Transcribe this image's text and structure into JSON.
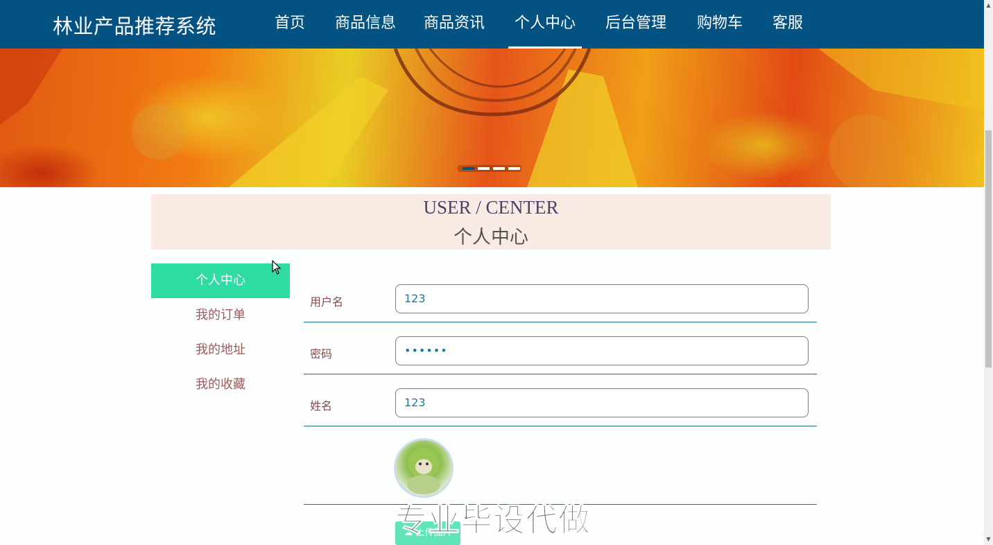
{
  "header": {
    "brand": "林业产品推荐系统",
    "nav": [
      "首页",
      "商品信息",
      "商品资讯",
      "个人中心",
      "后台管理",
      "购物车",
      "客服"
    ],
    "active_index": 3,
    "bg_color": "#045281"
  },
  "banner": {
    "slide_count": 4,
    "active_slide": 1
  },
  "page_title": {
    "en": "USER / CENTER",
    "cn": "个人中心"
  },
  "sidebar": {
    "items": [
      "个人中心",
      "我的订单",
      "我的地址",
      "我的收藏"
    ],
    "active_index": 0,
    "accent": "#2fdca4"
  },
  "form": {
    "username": {
      "label": "用户名",
      "value": "123"
    },
    "password": {
      "label": "密码",
      "value": "••••••"
    },
    "name": {
      "label": "姓名",
      "value": "123"
    },
    "upload_label": "上传图片"
  },
  "watermark": "专业毕设代做"
}
